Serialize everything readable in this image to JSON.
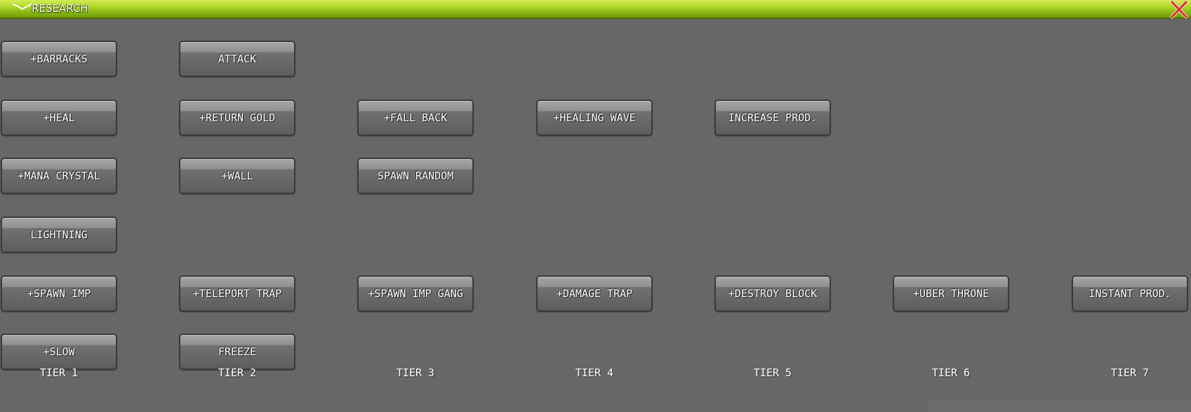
{
  "window": {
    "title": "RESEARCH",
    "close_icon": "close-x-icon",
    "collapse_icon": "chevron-down-icon",
    "accent_color": "#a9d12a",
    "close_color": "#d9322a"
  },
  "tiers": [
    {
      "label": "TIER 1",
      "buttons": [
        "+BARRACKS",
        "+HEAL",
        "+MANA CRYSTAL",
        "LIGHTNING",
        "+SPAWN IMP",
        "+SLOW"
      ]
    },
    {
      "label": "TIER 2",
      "buttons": [
        "ATTACK",
        "+RETURN GOLD",
        "+WALL",
        "",
        "+TELEPORT TRAP",
        "FREEZE"
      ]
    },
    {
      "label": "TIER 3",
      "buttons": [
        "",
        "+FALL BACK",
        "SPAWN RANDOM",
        "",
        "+SPAWN IMP GANG",
        ""
      ]
    },
    {
      "label": "TIER 4",
      "buttons": [
        "",
        "+HEALING WAVE",
        "",
        "",
        "+DAMAGE TRAP",
        ""
      ]
    },
    {
      "label": "TIER 5",
      "buttons": [
        "",
        "INCREASE PROD.",
        "",
        "",
        "+DESTROY BLOCK",
        ""
      ]
    },
    {
      "label": "TIER 6",
      "buttons": [
        "",
        "",
        "",
        "",
        "+UBER THRONE",
        ""
      ]
    },
    {
      "label": "TIER 7",
      "buttons": [
        "",
        "",
        "",
        "",
        "INSTANT PROD.",
        ""
      ]
    }
  ]
}
